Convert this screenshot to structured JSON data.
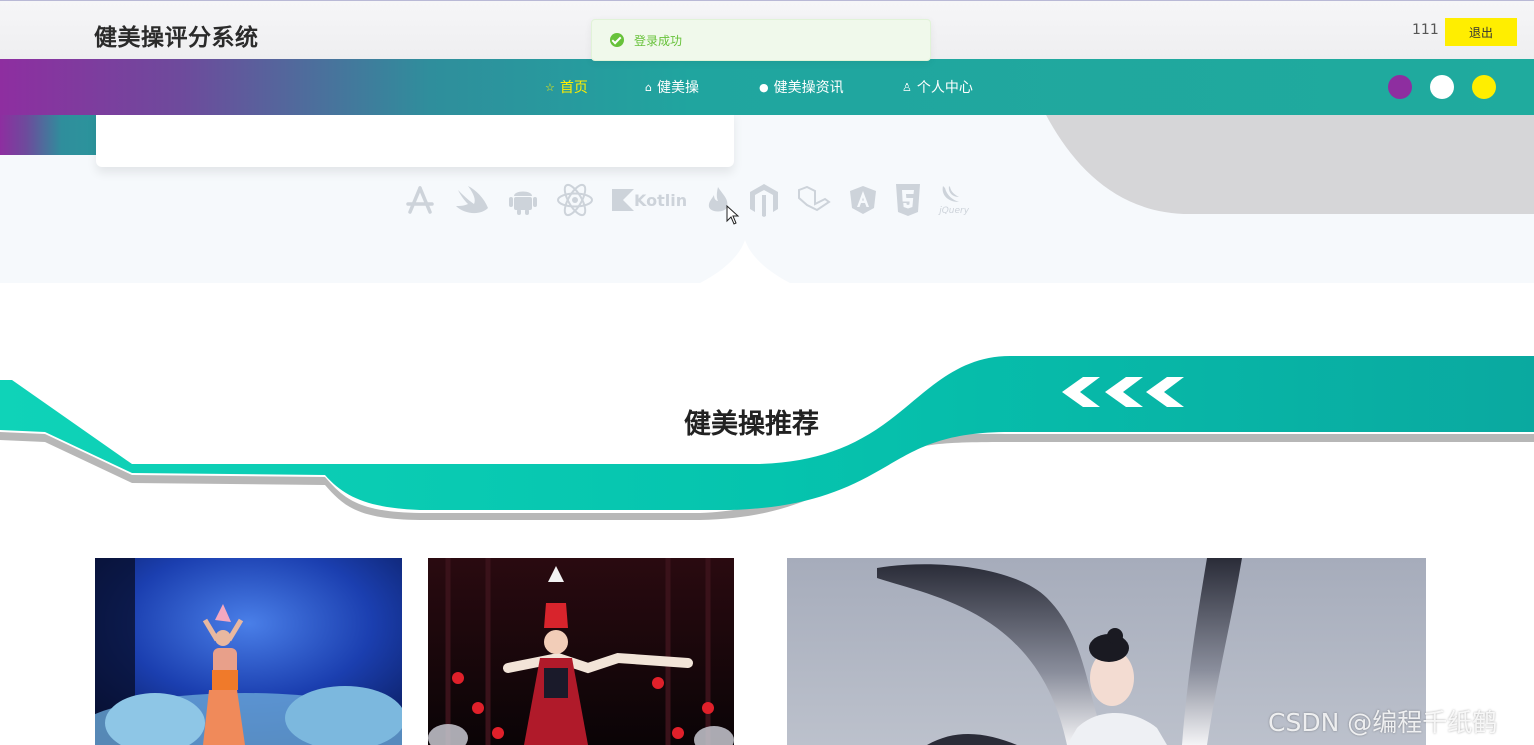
{
  "header": {
    "title": "健美操评分系统",
    "username": "111",
    "logout_label": "退出"
  },
  "toast": {
    "message": "登录成功",
    "icon": "check-circle-icon"
  },
  "nav": {
    "items": [
      {
        "label": "首页",
        "icon": "star-icon",
        "active": true
      },
      {
        "label": "健美操",
        "icon": "bag-icon",
        "active": false
      },
      {
        "label": "健美操资讯",
        "icon": "info-icon",
        "active": false
      },
      {
        "label": "个人中心",
        "icon": "user-icon",
        "active": false
      }
    ],
    "theme_colors": [
      "#8e2ea0",
      "#ffffff",
      "#ffee00"
    ]
  },
  "hero": {
    "tech_icons": [
      "app-store-icon",
      "swift-icon",
      "android-icon",
      "react-icon",
      "kotlin-icon",
      "flame-icon",
      "magento-icon",
      "laravel-icon",
      "angular-icon",
      "html5-icon",
      "jquery-icon"
    ],
    "kotlin_label": "Kotlin",
    "jquery_label": "jQuery"
  },
  "section": {
    "title": "健美操推荐"
  },
  "photos": [
    {
      "name": "photo-dancer-blue"
    },
    {
      "name": "photo-dancer-red"
    },
    {
      "name": "photo-dancer-sleeves"
    }
  ],
  "watermark": "CSDN @编程千纸鹤",
  "colors": {
    "accent_teal": "#1fab9e",
    "accent_purple": "#8e2ea0",
    "active_nav": "#ffee00",
    "success": "#67c23a"
  }
}
